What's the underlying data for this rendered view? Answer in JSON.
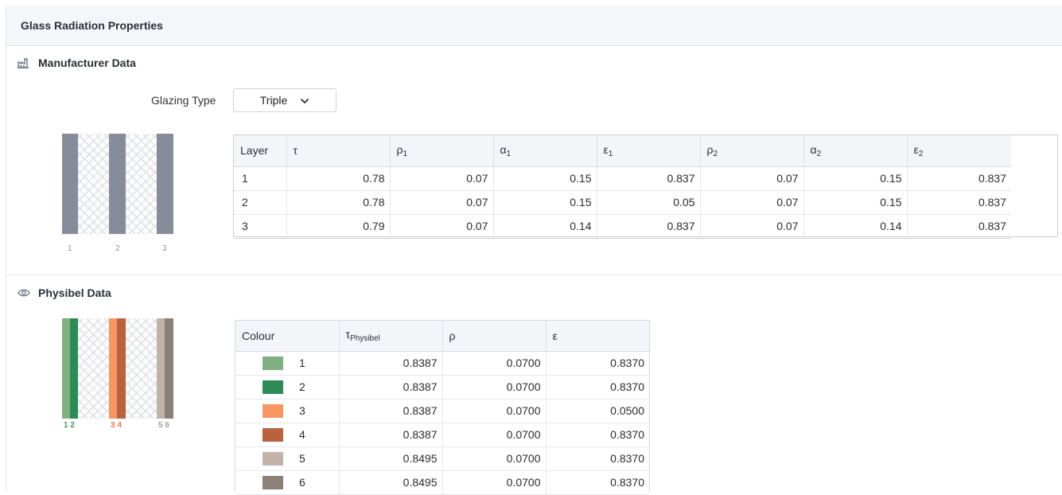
{
  "panel": {
    "title": "Glass Radiation Properties"
  },
  "manufacturer": {
    "title": "Manufacturer Data",
    "glazing_label": "Glazing Type",
    "glazing_value": "Triple",
    "diagram_numbers": [
      "1",
      "2",
      "3"
    ],
    "columns": [
      "Layer",
      "τ",
      "ρ",
      "1",
      "α",
      "1",
      "ε",
      "1",
      "ρ",
      "2",
      "α",
      "2",
      "ε",
      "2"
    ],
    "rows": [
      [
        "1",
        "0.78",
        "0.07",
        "0.15",
        "0.837",
        "0.07",
        "0.15",
        "0.837"
      ],
      [
        "2",
        "0.78",
        "0.07",
        "0.15",
        "0.05",
        "0.07",
        "0.15",
        "0.837"
      ],
      [
        "3",
        "0.79",
        "0.07",
        "0.14",
        "0.837",
        "0.07",
        "0.14",
        "0.837"
      ]
    ]
  },
  "physibel": {
    "title": "Physibel Data",
    "diagram_numbers": [
      "1 2",
      "3 4",
      "5 6"
    ],
    "diagram_number_colors": [
      "#3f9a5a",
      "#e07a4a",
      "#a89f98"
    ],
    "columns": {
      "colour": "Colour",
      "tau": "τ",
      "tau_sub": "Physibel",
      "rho": "ρ",
      "eps": "ε"
    },
    "rows": [
      {
        "id": "1",
        "color": "#7fb081",
        "tau": "0.8387",
        "rho": "0.0700",
        "eps": "0.8370"
      },
      {
        "id": "2",
        "color": "#2e8b57",
        "tau": "0.8387",
        "rho": "0.0700",
        "eps": "0.8370"
      },
      {
        "id": "3",
        "color": "#f79563",
        "tau": "0.8387",
        "rho": "0.0700",
        "eps": "0.0500"
      },
      {
        "id": "4",
        "color": "#b8623f",
        "tau": "0.8387",
        "rho": "0.0700",
        "eps": "0.8370"
      },
      {
        "id": "5",
        "color": "#c2b3a8",
        "tau": "0.8495",
        "rho": "0.0700",
        "eps": "0.8370"
      },
      {
        "id": "6",
        "color": "#8c8078",
        "tau": "0.8495",
        "rho": "0.0700",
        "eps": "0.8370"
      }
    ]
  },
  "colors": {
    "pane": "#868c99",
    "header_bg": "#f4f6f9"
  },
  "icons": {
    "manufacturer": "factory-icon",
    "physibel": "eye-icon",
    "dropdown": "chevron-down-icon"
  }
}
